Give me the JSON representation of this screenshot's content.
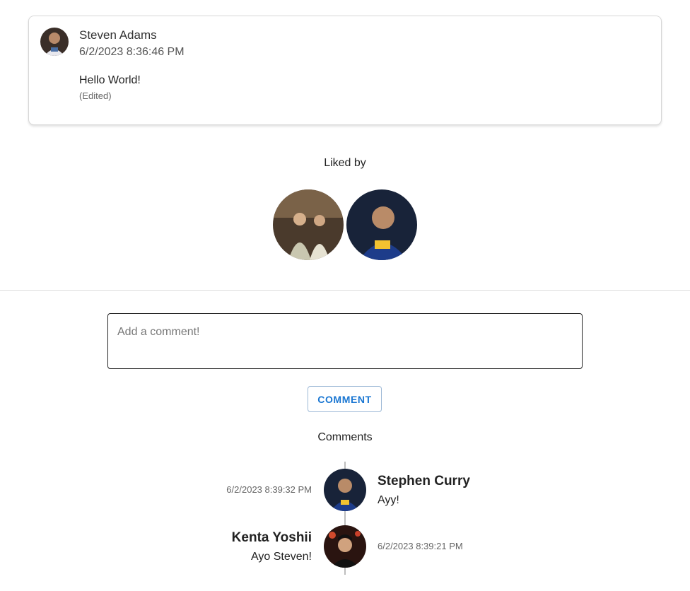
{
  "post": {
    "author": "Steven Adams",
    "date": "6/2/2023 8:36:46 PM",
    "body": "Hello World!",
    "edited": "(Edited)"
  },
  "likes": {
    "title": "Liked by"
  },
  "comment_input": {
    "placeholder": "Add a comment!",
    "button_label": "COMMENT"
  },
  "comments": {
    "title": "Comments",
    "items": [
      {
        "author": "Stephen Curry",
        "text": "Ayy!",
        "date": "6/2/2023 8:39:32 PM"
      },
      {
        "author": "Kenta Yoshii",
        "text": "Ayo Steven!",
        "date": "6/2/2023 8:39:21 PM"
      }
    ]
  },
  "colors": {
    "accent": "#1976d2",
    "border": "#d7d7d7"
  }
}
